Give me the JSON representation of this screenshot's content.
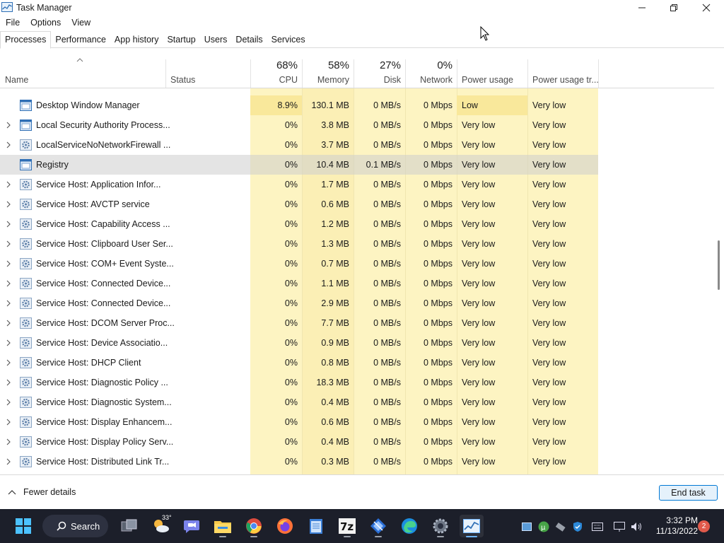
{
  "window": {
    "title": "Task Manager"
  },
  "menu": [
    "File",
    "Options",
    "View"
  ],
  "tabs": [
    {
      "label": "Processes",
      "active": true
    },
    {
      "label": "Performance"
    },
    {
      "label": "App history"
    },
    {
      "label": "Startup"
    },
    {
      "label": "Users"
    },
    {
      "label": "Details"
    },
    {
      "label": "Services"
    }
  ],
  "header": {
    "name": "Name",
    "status": "Status",
    "cpu": {
      "pct": "68%",
      "label": "CPU"
    },
    "memory": {
      "pct": "58%",
      "label": "Memory"
    },
    "disk": {
      "pct": "27%",
      "label": "Disk"
    },
    "network": {
      "pct": "0%",
      "label": "Network"
    },
    "power": "Power usage",
    "power_trend": "Power usage tr..."
  },
  "rows": [
    {
      "name": "Desktop Window Manager",
      "icon": "window-app-icon",
      "expandable": false,
      "cpu": "8.9%",
      "mem": "130.1 MB",
      "disk": "0 MB/s",
      "net": "0 Mbps",
      "power": "Low",
      "power_trend": "Very low",
      "highlight": true
    },
    {
      "name": "Local Security Authority Process...",
      "icon": "window-app-icon",
      "expandable": true,
      "cpu": "0%",
      "mem": "3.8 MB",
      "disk": "0 MB/s",
      "net": "0 Mbps",
      "power": "Very low",
      "power_trend": "Very low"
    },
    {
      "name": "LocalServiceNoNetworkFirewall ...",
      "icon": "gear-service-icon",
      "expandable": true,
      "cpu": "0%",
      "mem": "3.7 MB",
      "disk": "0 MB/s",
      "net": "0 Mbps",
      "power": "Very low",
      "power_trend": "Very low"
    },
    {
      "name": "Registry",
      "icon": "window-app-icon",
      "expandable": false,
      "cpu": "0%",
      "mem": "10.4 MB",
      "disk": "0.1 MB/s",
      "net": "0 Mbps",
      "power": "Very low",
      "power_trend": "Very low",
      "selected": true
    },
    {
      "name": "Service Host: Application Infor...",
      "icon": "gear-service-icon",
      "expandable": true,
      "cpu": "0%",
      "mem": "1.7 MB",
      "disk": "0 MB/s",
      "net": "0 Mbps",
      "power": "Very low",
      "power_trend": "Very low"
    },
    {
      "name": "Service Host: AVCTP service",
      "icon": "gear-service-icon",
      "expandable": true,
      "cpu": "0%",
      "mem": "0.6 MB",
      "disk": "0 MB/s",
      "net": "0 Mbps",
      "power": "Very low",
      "power_trend": "Very low"
    },
    {
      "name": "Service Host: Capability Access ...",
      "icon": "gear-service-icon",
      "expandable": true,
      "cpu": "0%",
      "mem": "1.2 MB",
      "disk": "0 MB/s",
      "net": "0 Mbps",
      "power": "Very low",
      "power_trend": "Very low"
    },
    {
      "name": "Service Host: Clipboard User Ser...",
      "icon": "gear-service-icon",
      "expandable": true,
      "cpu": "0%",
      "mem": "1.3 MB",
      "disk": "0 MB/s",
      "net": "0 Mbps",
      "power": "Very low",
      "power_trend": "Very low"
    },
    {
      "name": "Service Host: COM+ Event Syste...",
      "icon": "gear-service-icon",
      "expandable": true,
      "cpu": "0%",
      "mem": "0.7 MB",
      "disk": "0 MB/s",
      "net": "0 Mbps",
      "power": "Very low",
      "power_trend": "Very low"
    },
    {
      "name": "Service Host: Connected Device...",
      "icon": "gear-service-icon",
      "expandable": true,
      "cpu": "0%",
      "mem": "1.1 MB",
      "disk": "0 MB/s",
      "net": "0 Mbps",
      "power": "Very low",
      "power_trend": "Very low"
    },
    {
      "name": "Service Host: Connected Device...",
      "icon": "gear-service-icon",
      "expandable": true,
      "cpu": "0%",
      "mem": "2.9 MB",
      "disk": "0 MB/s",
      "net": "0 Mbps",
      "power": "Very low",
      "power_trend": "Very low"
    },
    {
      "name": "Service Host: DCOM Server Proc...",
      "icon": "gear-service-icon",
      "expandable": true,
      "cpu": "0%",
      "mem": "7.7 MB",
      "disk": "0 MB/s",
      "net": "0 Mbps",
      "power": "Very low",
      "power_trend": "Very low"
    },
    {
      "name": "Service Host: Device Associatio...",
      "icon": "gear-service-icon",
      "expandable": true,
      "cpu": "0%",
      "mem": "0.9 MB",
      "disk": "0 MB/s",
      "net": "0 Mbps",
      "power": "Very low",
      "power_trend": "Very low"
    },
    {
      "name": "Service Host: DHCP Client",
      "icon": "gear-service-icon",
      "expandable": true,
      "cpu": "0%",
      "mem": "0.8 MB",
      "disk": "0 MB/s",
      "net": "0 Mbps",
      "power": "Very low",
      "power_trend": "Very low"
    },
    {
      "name": "Service Host: Diagnostic Policy ...",
      "icon": "gear-service-icon",
      "expandable": true,
      "cpu": "0%",
      "mem": "18.3 MB",
      "disk": "0 MB/s",
      "net": "0 Mbps",
      "power": "Very low",
      "power_trend": "Very low"
    },
    {
      "name": "Service Host: Diagnostic System...",
      "icon": "gear-service-icon",
      "expandable": true,
      "cpu": "0%",
      "mem": "0.4 MB",
      "disk": "0 MB/s",
      "net": "0 Mbps",
      "power": "Very low",
      "power_trend": "Very low"
    },
    {
      "name": "Service Host: Display Enhancem...",
      "icon": "gear-service-icon",
      "expandable": true,
      "cpu": "0%",
      "mem": "0.6 MB",
      "disk": "0 MB/s",
      "net": "0 Mbps",
      "power": "Very low",
      "power_trend": "Very low"
    },
    {
      "name": "Service Host: Display Policy Serv...",
      "icon": "gear-service-icon",
      "expandable": true,
      "cpu": "0%",
      "mem": "0.4 MB",
      "disk": "0 MB/s",
      "net": "0 Mbps",
      "power": "Very low",
      "power_trend": "Very low"
    },
    {
      "name": "Service Host: Distributed Link Tr...",
      "icon": "gear-service-icon",
      "expandable": true,
      "cpu": "0%",
      "mem": "0.3 MB",
      "disk": "0 MB/s",
      "net": "0 Mbps",
      "power": "Very low",
      "power_trend": "Very low"
    }
  ],
  "footer": {
    "fewer_details": "Fewer details",
    "end_task": "End task"
  },
  "taskbar": {
    "search_label": "Search",
    "weather_temp": "33°",
    "apps": [
      "start-icon",
      "task-view-icon",
      "weather-widget-icon",
      "chat-icon",
      "file-explorer-icon",
      "chrome-icon",
      "firefox-icon",
      "notepad-icon",
      "7zip-icon",
      "snipping-tool-icon",
      "edge-icon",
      "settings-icon",
      "task-manager-icon"
    ],
    "clock_time": "3:32 PM",
    "clock_date": "11/13/2022",
    "notification_count": "2"
  },
  "colors": {
    "accent": "#0078d4",
    "highlight": "#fdf4c2",
    "taskbar": "#1c1f2a"
  }
}
